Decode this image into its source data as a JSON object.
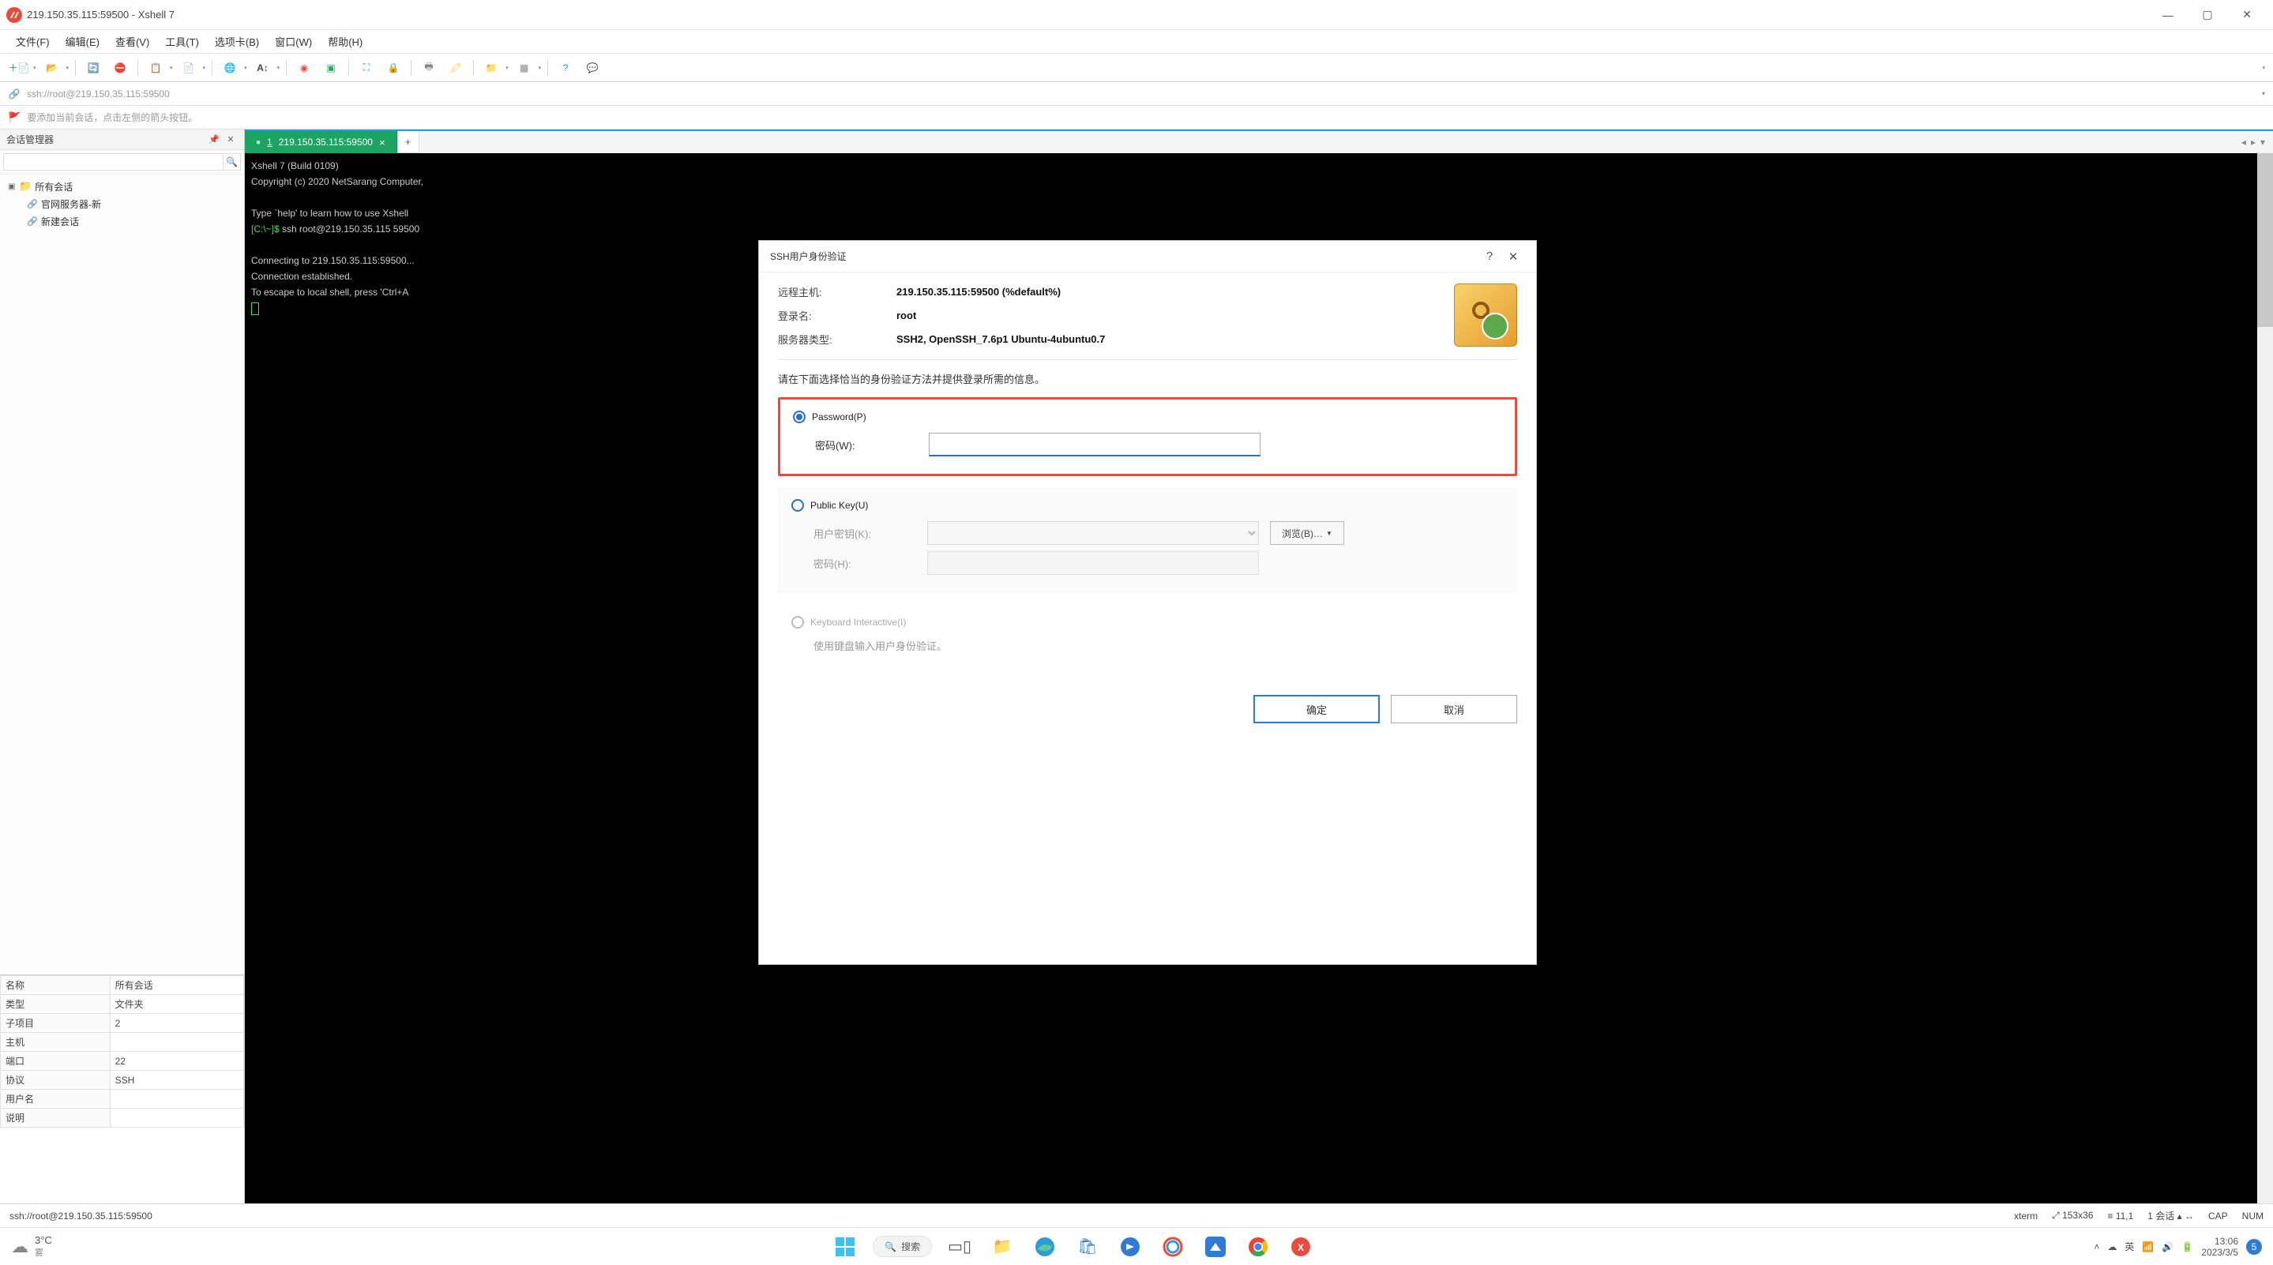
{
  "title": "219.150.35.115:59500 - Xshell 7",
  "menus": [
    "文件(F)",
    "编辑(E)",
    "查看(V)",
    "工具(T)",
    "选项卡(B)",
    "窗口(W)",
    "帮助(H)"
  ],
  "address": "ssh://root@219.150.35.115:59500",
  "hint": "要添加当前会话，点击左侧的箭头按钮。",
  "session_panel": {
    "title": "会话管理器",
    "root": "所有会话",
    "children": [
      "官网服务器-新",
      "新建会话"
    ]
  },
  "tab": {
    "index": "1",
    "label": "219.150.35.115:59500"
  },
  "terminal": {
    "l1": "Xshell 7 (Build 0109)",
    "l2": "Copyright (c) 2020 NetSarang Computer, ",
    "l3": "Type `help' to learn how to use Xshell ",
    "prompt": "[C:\\~]$ ",
    "cmd": "ssh root@219.150.35.115 59500",
    "l5": "Connecting to 219.150.35.115:59500...",
    "l6": "Connection established.",
    "l7": "To escape to local shell, press 'Ctrl+A"
  },
  "props": [
    [
      "名称",
      "所有会话"
    ],
    [
      "类型",
      "文件夹"
    ],
    [
      "子项目",
      "2"
    ],
    [
      "主机",
      ""
    ],
    [
      "端口",
      "22"
    ],
    [
      "协议",
      "SSH"
    ],
    [
      "用户名",
      ""
    ],
    [
      "说明",
      ""
    ]
  ],
  "status": {
    "left": "ssh://root@219.150.35.115:59500",
    "term": "xterm",
    "size": "153x36",
    "pos": "11,1",
    "sess": "1 会话",
    "cap": "CAP",
    "num": "NUM"
  },
  "dialog": {
    "title": "SSH用户身份验证",
    "host_lbl": "远程主机:",
    "host_val": "219.150.35.115:59500 (%default%)",
    "login_lbl": "登录名:",
    "login_val": "root",
    "srv_lbl": "服务器类型:",
    "srv_val": "SSH2, OpenSSH_7.6p1 Ubuntu-4ubuntu0.7",
    "instr": "请在下面选择恰当的身份验证方法并提供登录所需的信息。",
    "password_lbl": "Password(P)",
    "pw_field_lbl": "密码(W):",
    "pubkey_lbl": "Public Key(U)",
    "userkey_lbl": "用户密钥(K):",
    "pw2_lbl": "密码(H):",
    "browse": "浏览(B)…",
    "kb_lbl": "Keyboard Interactive(I)",
    "kb_hint": "使用键盘输入用户身份验证。",
    "ok": "确定",
    "cancel": "取消"
  },
  "taskbar": {
    "temp": "3°C",
    "weather": "雾",
    "search": "搜索",
    "ime": "英",
    "time": "13:06",
    "date": "2023/3/5",
    "notif": "5"
  }
}
